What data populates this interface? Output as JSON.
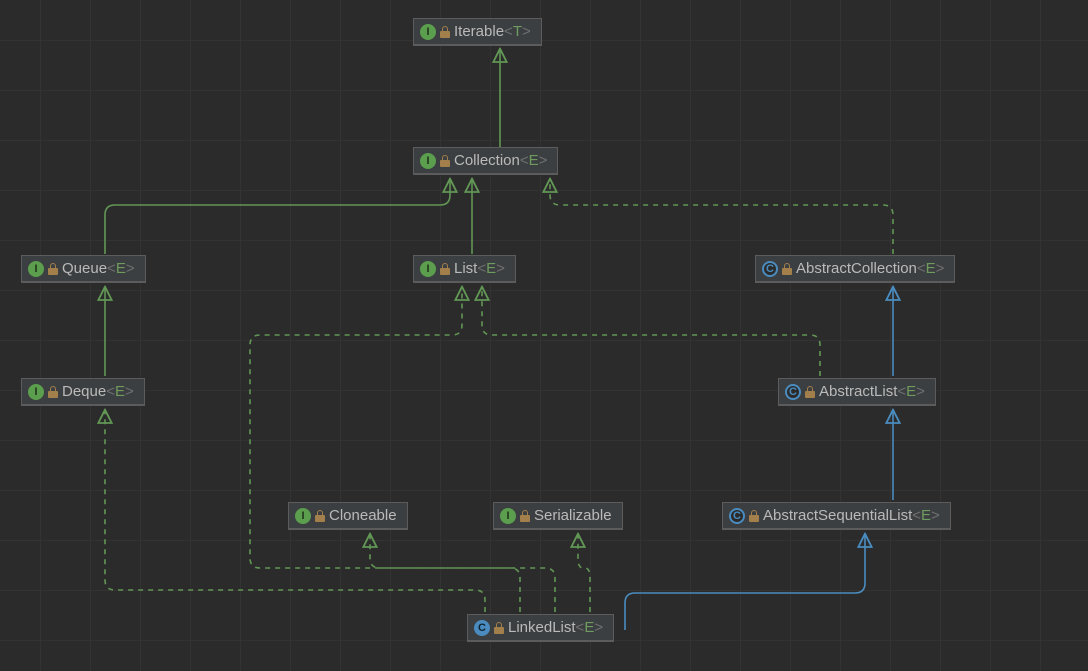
{
  "nodes": {
    "iterable": {
      "name": "Iterable",
      "param": "T",
      "kind": "interface"
    },
    "collection": {
      "name": "Collection",
      "param": "E",
      "kind": "interface"
    },
    "queue": {
      "name": "Queue",
      "param": "E",
      "kind": "interface"
    },
    "list": {
      "name": "List",
      "param": "E",
      "kind": "interface"
    },
    "abscoll": {
      "name": "AbstractCollection",
      "param": "E",
      "kind": "abstract-class"
    },
    "deque": {
      "name": "Deque",
      "param": "E",
      "kind": "interface"
    },
    "abslist": {
      "name": "AbstractList",
      "param": "E",
      "kind": "abstract-class"
    },
    "cloneable": {
      "name": "Cloneable",
      "param": "",
      "kind": "interface"
    },
    "serializable": {
      "name": "Serializable",
      "param": "",
      "kind": "interface"
    },
    "absseq": {
      "name": "AbstractSequentialList",
      "param": "E",
      "kind": "abstract-class"
    },
    "linkedlist": {
      "name": "LinkedList",
      "param": "E",
      "kind": "class"
    }
  },
  "edges": [
    {
      "from": "collection",
      "to": "iterable",
      "style": "solid",
      "color": "green"
    },
    {
      "from": "queue",
      "to": "collection",
      "style": "solid",
      "color": "green"
    },
    {
      "from": "list",
      "to": "collection",
      "style": "solid",
      "color": "green"
    },
    {
      "from": "abscoll",
      "to": "collection",
      "style": "dashed",
      "color": "green"
    },
    {
      "from": "deque",
      "to": "queue",
      "style": "solid",
      "color": "green"
    },
    {
      "from": "abslist",
      "to": "abscoll",
      "style": "solid",
      "color": "blue"
    },
    {
      "from": "abslist",
      "to": "list",
      "style": "dashed",
      "color": "green"
    },
    {
      "from": "absseq",
      "to": "abslist",
      "style": "solid",
      "color": "blue"
    },
    {
      "from": "linkedlist",
      "to": "absseq",
      "style": "solid",
      "color": "blue"
    },
    {
      "from": "linkedlist",
      "to": "deque",
      "style": "dashed",
      "color": "green"
    },
    {
      "from": "linkedlist",
      "to": "list",
      "style": "dashed",
      "color": "green"
    },
    {
      "from": "linkedlist",
      "to": "cloneable",
      "style": "dashed",
      "color": "green"
    },
    {
      "from": "linkedlist",
      "to": "serializable",
      "style": "dashed",
      "color": "green"
    }
  ],
  "colors": {
    "green": "#629755",
    "blue": "#4a8cbf"
  },
  "badge_letters": {
    "interface": "I",
    "class": "C",
    "abstract-class": "C"
  },
  "angle_open": "<",
  "angle_close": ">"
}
